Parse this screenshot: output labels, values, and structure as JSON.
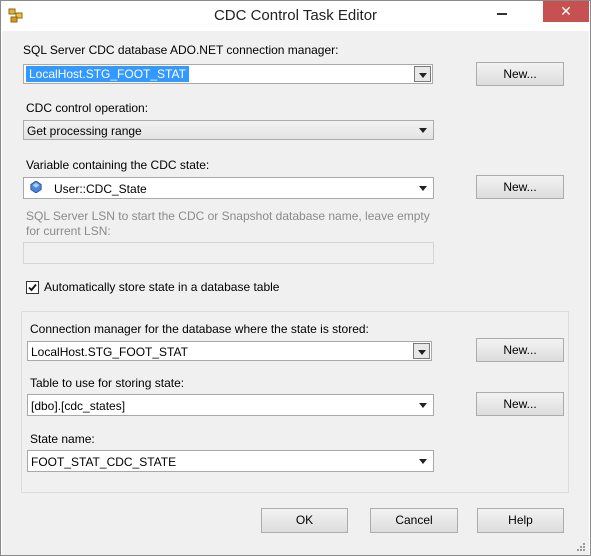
{
  "window": {
    "title": "CDC Control Task Editor",
    "close_glyph": "✕",
    "minimize_icon": "minimize-icon",
    "app_icon": "ssis-task-icon"
  },
  "connection_manager": {
    "label": "SQL Server CDC database ADO.NET connection manager:",
    "value": "LocalHost.STG_FOOT_STAT",
    "new_button": "New..."
  },
  "operation": {
    "label": "CDC control operation:",
    "value": "Get processing range"
  },
  "state_variable": {
    "label": "Variable containing the CDC state:",
    "value": "User::CDC_State",
    "icon": "variable-icon",
    "new_button": "New..."
  },
  "lsn": {
    "label": "SQL Server LSN to start the CDC or Snapshot database name, leave empty for current LSN:",
    "value": ""
  },
  "auto_store": {
    "label": "Automatically store state in a database table",
    "checked": true
  },
  "state_connection": {
    "label": "Connection manager for the database where the state is stored:",
    "value": "LocalHost.STG_FOOT_STAT",
    "new_button": "New..."
  },
  "state_table": {
    "label": "Table to use for storing state:",
    "value": "[dbo].[cdc_states]",
    "new_button": "New..."
  },
  "state_name": {
    "label": "State name:",
    "value": "FOOT_STAT_CDC_STATE"
  },
  "buttons": {
    "ok": "OK",
    "cancel": "Cancel",
    "help": "Help"
  },
  "colors": {
    "accent_selection": "#3399ff",
    "close_button": "#c75050",
    "dialog_background": "#f0f0f0"
  }
}
